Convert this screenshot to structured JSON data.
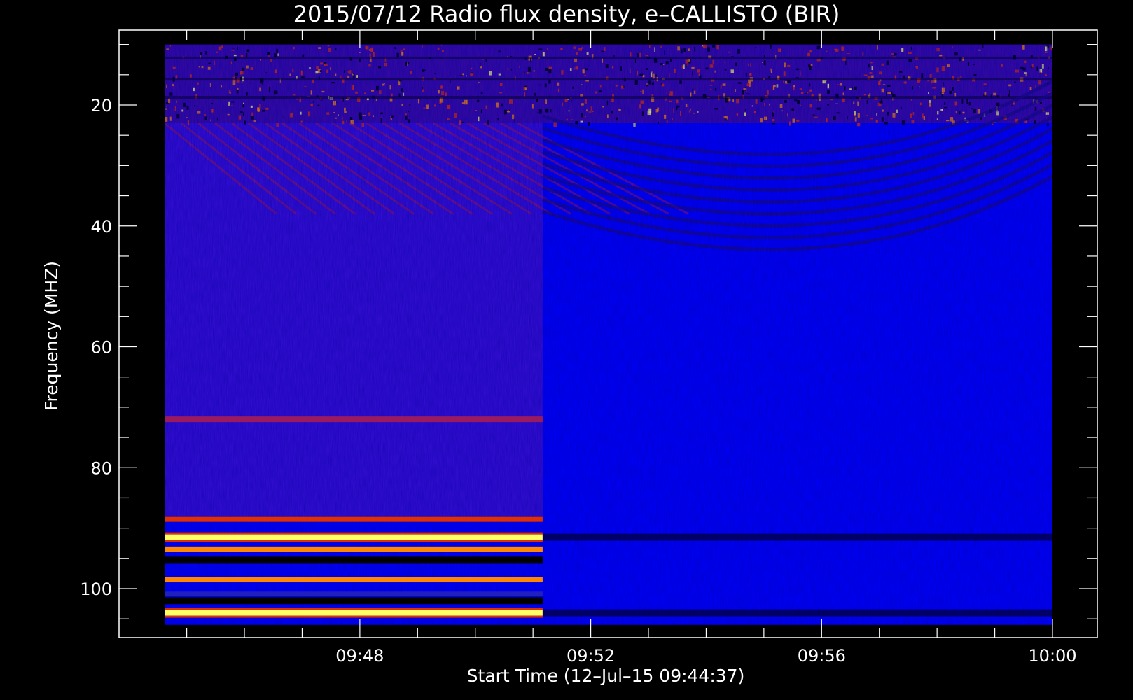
{
  "chart_data": {
    "type": "heatmap",
    "title": "2015/07/12  Radio flux density, e–CALLISTO (BIR)",
    "xlabel": "Start Time (12–Jul–15 09:44:37)",
    "ylabel": "Frequency (MHZ)",
    "x_ticks": [
      "09:48",
      "09:52",
      "09:56",
      "10:00"
    ],
    "y_ticks": [
      "20",
      "40",
      "60",
      "80",
      "100"
    ],
    "x_range": [
      "09:44:37",
      "10:00:00"
    ],
    "ylim": [
      10,
      108
    ],
    "y_inverted": true,
    "data_extent": {
      "x": [
        "09:44:37",
        "10:00:00"
      ],
      "y": [
        10,
        106
      ]
    },
    "receiver_switch_time": "09:51:10",
    "colormap": [
      "#000000",
      "#0000ff",
      "#7a1fa0",
      "#e03000",
      "#ff8800",
      "#ffff66"
    ],
    "background_level": "blue",
    "strong_bands_mhz": [
      {
        "freq": 91.5,
        "segment": "before",
        "level": "bright-yellow"
      },
      {
        "freq": 93.5,
        "segment": "before",
        "level": "orange"
      },
      {
        "freq": 98.5,
        "segment": "before",
        "level": "orange"
      },
      {
        "freq": 104.0,
        "segment": "before",
        "level": "bright-yellow"
      },
      {
        "freq": 88.5,
        "segment": "before",
        "level": "red"
      },
      {
        "freq": 72.0,
        "segment": "before",
        "level": "dark-red"
      }
    ],
    "dark_bands_mhz": [
      {
        "freq": 95.3,
        "segment": "before"
      },
      {
        "freq": 102.0,
        "segment": "before"
      },
      {
        "freq": 91.5,
        "segment": "after"
      },
      {
        "freq": 104.0,
        "segment": "after"
      }
    ],
    "noisy_region_mhz": [
      10,
      23
    ],
    "colors": {
      "background": "#000000",
      "axis": "#ffffff"
    }
  }
}
